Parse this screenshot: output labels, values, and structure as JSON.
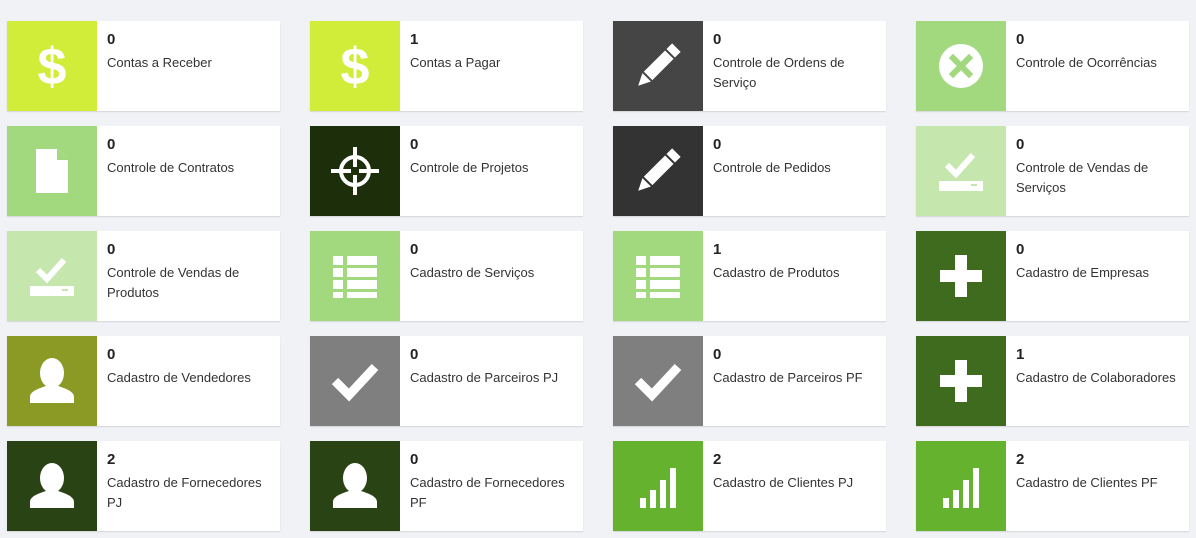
{
  "tiles": [
    {
      "count": "0",
      "label": "Contas a Receber",
      "color": "#d2ec3a",
      "icon": "dollar-icon"
    },
    {
      "count": "1",
      "label": "Contas a Pagar",
      "color": "#d2ec3a",
      "icon": "dollar-icon"
    },
    {
      "count": "0",
      "label": "Controle de Ordens de Serviço",
      "color": "#454545",
      "icon": "pencil-icon"
    },
    {
      "count": "0",
      "label": "Controle de Ocorrências",
      "color": "#a2d97f",
      "icon": "remove-circle-icon"
    },
    {
      "count": "0",
      "label": "Controle de Contratos",
      "color": "#a2d97f",
      "icon": "document-icon"
    },
    {
      "count": "0",
      "label": "Controle de Projetos",
      "color": "#1c2f0a",
      "icon": "crosshair-icon"
    },
    {
      "count": "0",
      "label": "Controle de Pedidos",
      "color": "#333333",
      "icon": "pencil-icon"
    },
    {
      "count": "0",
      "label": "Controle de Vendas de Serviços",
      "color": "#c5e6ac",
      "icon": "inbox-check-icon"
    },
    {
      "count": "0",
      "label": "Controle de Vendas de Produtos",
      "color": "#c5e6ac",
      "icon": "inbox-check-icon"
    },
    {
      "count": "0",
      "label": "Cadastro de Serviços",
      "color": "#a2d97f",
      "icon": "list-icon"
    },
    {
      "count": "1",
      "label": "Cadastro de Produtos",
      "color": "#a2d97f",
      "icon": "list-icon"
    },
    {
      "count": "0",
      "label": "Cadastro de Empresas",
      "color": "#3f6b1f",
      "icon": "plus-icon"
    },
    {
      "count": "0",
      "label": "Cadastro de Vendedores",
      "color": "#8a9a25",
      "icon": "user-icon"
    },
    {
      "count": "0",
      "label": "Cadastro de Parceiros PJ",
      "color": "#7f7f7f",
      "icon": "checkmark-icon"
    },
    {
      "count": "0",
      "label": "Cadastro de Parceiros PF",
      "color": "#7f7f7f",
      "icon": "checkmark-icon"
    },
    {
      "count": "1",
      "label": "Cadastro de Colaboradores",
      "color": "#3f6b1f",
      "icon": "plus-icon"
    },
    {
      "count": "2",
      "label": "Cadastro de Fornecedores PJ",
      "color": "#2a4315",
      "icon": "user-icon"
    },
    {
      "count": "0",
      "label": "Cadastro de Fornecedores PF",
      "color": "#2a4315",
      "icon": "user-icon"
    },
    {
      "count": "2",
      "label": "Cadastro de Clientes PJ",
      "color": "#64b22e",
      "icon": "signal-bars-icon"
    },
    {
      "count": "2",
      "label": "Cadastro de Clientes PF",
      "color": "#64b22e",
      "icon": "signal-bars-icon"
    }
  ]
}
